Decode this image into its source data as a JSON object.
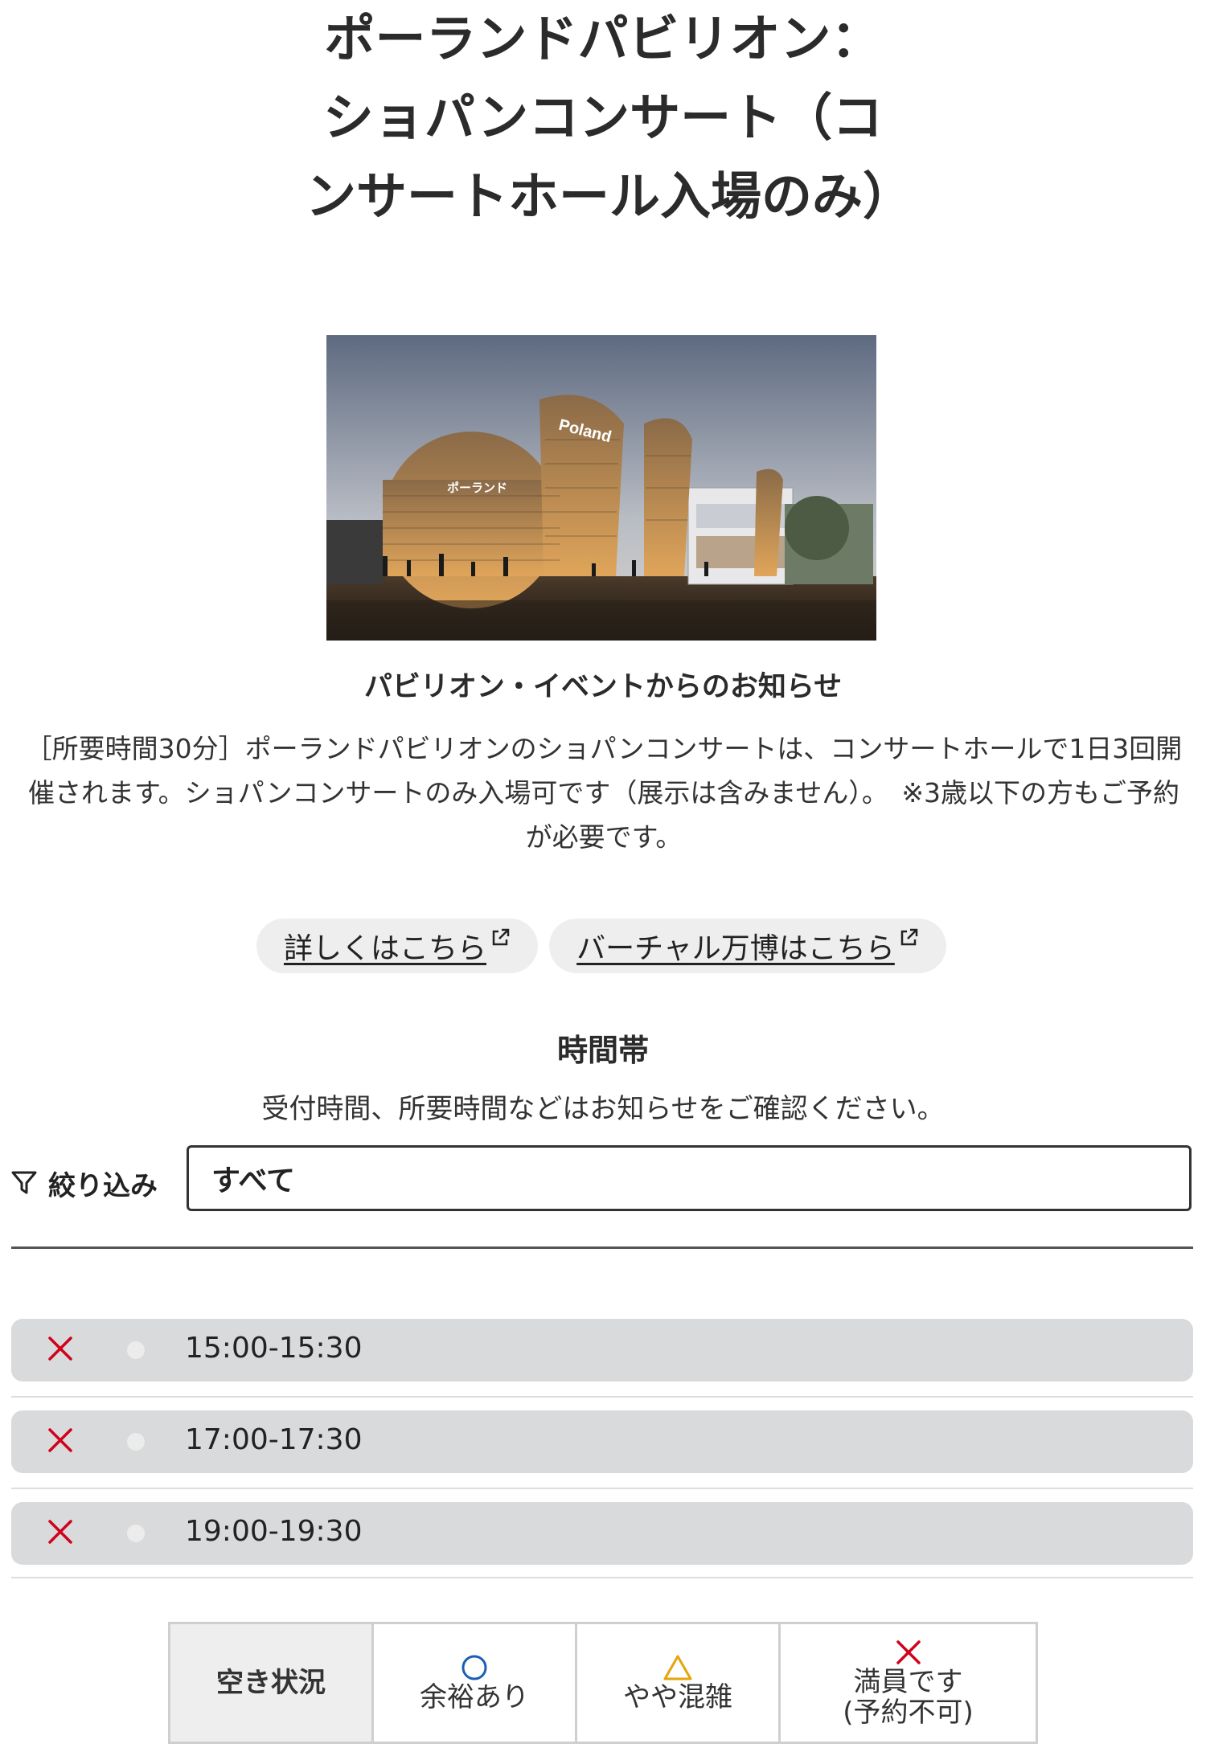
{
  "title": "ポーランドパビリオン：ショパンコンサート（コンサートホール入場のみ）",
  "hero_image": {
    "sign_latin": "Poland",
    "sign_kana": "ポーランド"
  },
  "notice": {
    "heading": "パビリオン・イベントからのお知らせ",
    "body": "［所要時間30分］ポーランドパビリオンのショパンコンサートは、コンサートホールで1日3回開催されます。ショパンコンサートのみ入場可です（展示は含みません）。　※3歳以下の方もご予約が必要です。"
  },
  "links": [
    {
      "label": "詳しくはこちら",
      "icon": "external-link-icon"
    },
    {
      "label": "バーチャル万博はこちら",
      "icon": "external-link-icon"
    }
  ],
  "timeslots_section": {
    "title": "時間帯",
    "subtitle": "受付時間、所要時間などはお知らせをご確認ください。"
  },
  "filter": {
    "label": "絞り込み",
    "icon": "filter-icon",
    "selected": "すべて"
  },
  "slots": [
    {
      "status": "full",
      "status_icon": "cross-icon",
      "time": "15:00-15:30"
    },
    {
      "status": "full",
      "status_icon": "cross-icon",
      "time": "17:00-17:30"
    },
    {
      "status": "full",
      "status_icon": "cross-icon",
      "time": "19:00-19:30"
    }
  ],
  "legend": {
    "heading": "空き状況",
    "items": [
      {
        "icon": "circle-icon",
        "color": "#1a5fb4",
        "label": "余裕あり"
      },
      {
        "icon": "triangle-icon",
        "color": "#e5a50a",
        "label": "やや混雑"
      },
      {
        "icon": "cross-icon",
        "color": "#d0021b",
        "label_line1": "満員です",
        "label_line2": "(予約不可)"
      }
    ]
  },
  "colors": {
    "full": "#d0021b",
    "slot_bg": "#d8dadc",
    "text": "#222222"
  }
}
